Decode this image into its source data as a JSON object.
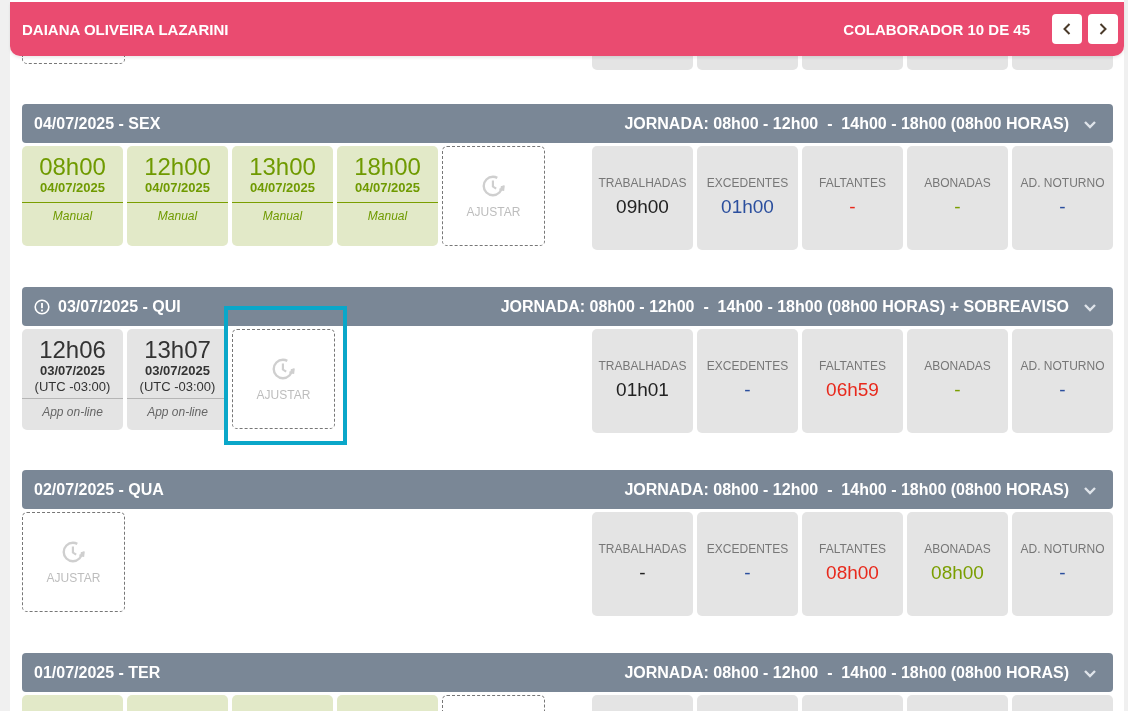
{
  "header": {
    "name": "DAIANA OLIVEIRA LAZARINI",
    "counter": "COLABORADOR 10 DE 45"
  },
  "days": [
    {
      "date": "04/07/2025 - SEX",
      "alert": false,
      "schedule": "JORNADA: 08h00 - 12h00  -  14h00 - 18h00 (08h00 HORAS)",
      "punches": [
        {
          "kind": "manual",
          "time": "08h00",
          "date": "04/07/2025",
          "source": "Manual"
        },
        {
          "kind": "manual",
          "time": "12h00",
          "date": "04/07/2025",
          "source": "Manual"
        },
        {
          "kind": "manual",
          "time": "13h00",
          "date": "04/07/2025",
          "source": "Manual"
        },
        {
          "kind": "manual",
          "time": "18h00",
          "date": "04/07/2025",
          "source": "Manual"
        }
      ],
      "adjust": {
        "label": "AJUSTAR",
        "highlighted": false
      },
      "stats": [
        {
          "label": "TRABALHADAS",
          "value": "09h00",
          "color": "#222222"
        },
        {
          "label": "EXCEDENTES",
          "value": "01h00",
          "color": "#2b4f9e"
        },
        {
          "label": "FALTANTES",
          "value": "-",
          "color": "#e8291c"
        },
        {
          "label": "ABONADAS",
          "value": "-",
          "color": "#7a9e00"
        },
        {
          "label": "AD. NOTURNO",
          "value": "-",
          "color": "#2b4f9e"
        }
      ]
    },
    {
      "date": "03/07/2025 - QUI",
      "alert": true,
      "schedule": "JORNADA: 08h00 - 12h00  -  14h00 - 18h00 (08h00 HORAS) + SOBREAVISO",
      "punches": [
        {
          "kind": "app",
          "time": "12h06",
          "date": "03/07/2025",
          "zone": "(UTC -03:00)",
          "source": "App on-line"
        },
        {
          "kind": "app",
          "time": "13h07",
          "date": "03/07/2025",
          "zone": "(UTC -03:00)",
          "source": "App on-line"
        }
      ],
      "adjust": {
        "label": "AJUSTAR",
        "highlighted": true
      },
      "stats": [
        {
          "label": "TRABALHADAS",
          "value": "01h01",
          "color": "#222222"
        },
        {
          "label": "EXCEDENTES",
          "value": "-",
          "color": "#2b4f9e"
        },
        {
          "label": "FALTANTES",
          "value": "06h59",
          "color": "#e8291c"
        },
        {
          "label": "ABONADAS",
          "value": "-",
          "color": "#7a9e00"
        },
        {
          "label": "AD. NOTURNO",
          "value": "-",
          "color": "#2b4f9e"
        }
      ]
    },
    {
      "date": "02/07/2025 - QUA",
      "alert": false,
      "schedule": "JORNADA: 08h00 - 12h00  -  14h00 - 18h00 (08h00 HORAS)",
      "adjust": {
        "label": "AJUSTAR",
        "highlighted": false
      },
      "stats": [
        {
          "label": "TRABALHADAS",
          "value": "-",
          "color": "#222222"
        },
        {
          "label": "EXCEDENTES",
          "value": "-",
          "color": "#2b4f9e"
        },
        {
          "label": "FALTANTES",
          "value": "08h00",
          "color": "#e8291c"
        },
        {
          "label": "ABONADAS",
          "value": "08h00",
          "color": "#7a9e00"
        },
        {
          "label": "AD. NOTURNO",
          "value": "-",
          "color": "#2b4f9e"
        }
      ]
    },
    {
      "date": "01/07/2025 - TER",
      "alert": false,
      "schedule": "JORNADA: 08h00 - 12h00  -  14h00 - 18h00 (08h00 HORAS)",
      "punches": [
        {
          "kind": "manual"
        },
        {
          "kind": "manual"
        },
        {
          "kind": "manual"
        },
        {
          "kind": "manual"
        }
      ],
      "adjust": {
        "highlighted": false
      }
    }
  ]
}
